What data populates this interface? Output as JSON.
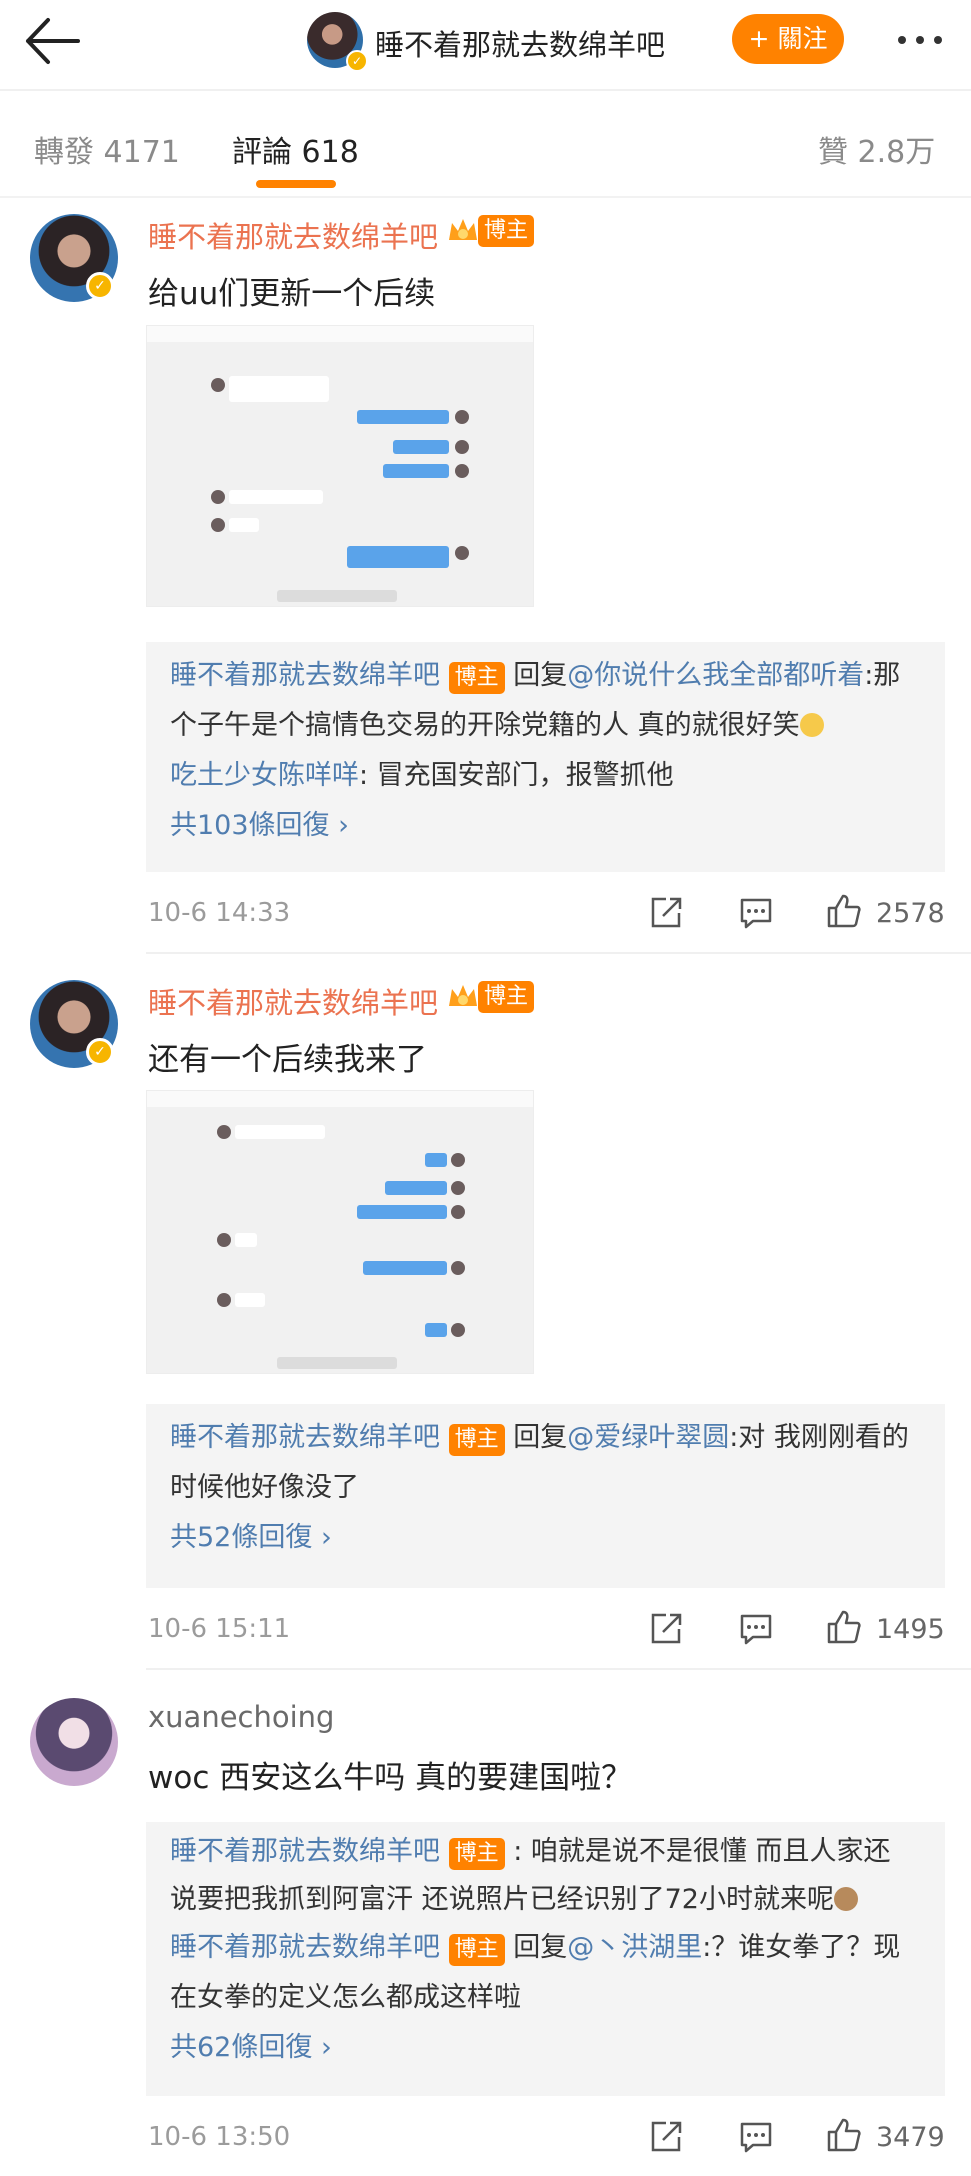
{
  "header": {
    "title": "睡不着那就去数绵羊吧",
    "follow_label": "+ 關注"
  },
  "tabs": {
    "repost": "轉發 4171",
    "comment": "評論 618",
    "likes": "贊 2.8万"
  },
  "comments": [
    {
      "author": "睡不着那就去数绵羊吧",
      "role_tag": "博主",
      "text": "给uu们更新一个后续",
      "replies": [
        {
          "author": "睡不着那就去数绵羊吧",
          "tag": "博主",
          "prefix": "回复",
          "mention": "@你说什么我全部都听着",
          "line1": ":那",
          "line2": "个子午是个搞情色交易的开除党籍的人 真的就很好笑"
        },
        {
          "author": "吃土少女陈咩咩",
          "text": ": 冒充国安部门，报警抓他"
        }
      ],
      "more_replies": "共103條回復 ›",
      "time": "10-6 14:33",
      "likes": "2578"
    },
    {
      "author": "睡不着那就去数绵羊吧",
      "role_tag": "博主",
      "text": "还有一个后续我来了",
      "replies": [
        {
          "author": "睡不着那就去数绵羊吧",
          "tag": "博主",
          "prefix": "回复",
          "mention": "@爱绿叶翠圆",
          "line1": ":对 我刚刚看的",
          "line2": "时候他好像没了"
        }
      ],
      "more_replies": "共52條回復 ›",
      "time": "10-6 15:11",
      "likes": "1495"
    },
    {
      "author": "xuanechoing",
      "text": "woc 西安这么牛吗 真的要建国啦？",
      "replies": [
        {
          "author": "睡不着那就去数绵羊吧",
          "tag": "博主",
          "line1": ": 咱就是说不是很懂 而且人家还",
          "line2": "说要把我抓到阿富汗 还说照片已经识别了72小时就来呢"
        },
        {
          "author": "睡不着那就去数绵羊吧",
          "tag": "博主",
          "prefix": "回复",
          "mention": "@丶洪湖里",
          "line1": ":？谁女拳了？现",
          "line2": "在女拳的定义怎么都成这样啦"
        }
      ],
      "more_replies": "共62條回復 ›",
      "time": "10-6 13:50",
      "likes": "3479"
    }
  ],
  "colors": {
    "accent": "#ff8200",
    "name": "#eb7350",
    "link": "#507daf",
    "reply_bg": "#f4f4f4"
  }
}
